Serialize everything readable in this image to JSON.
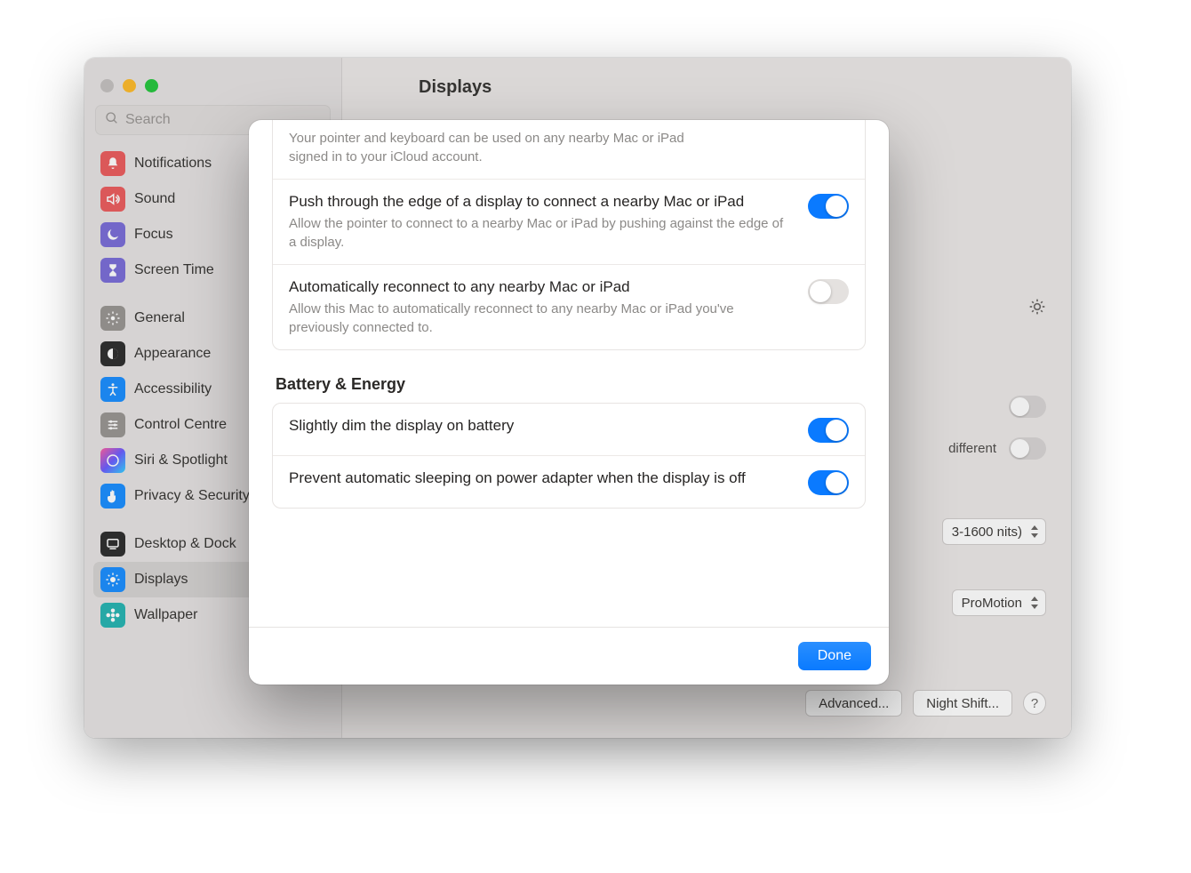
{
  "header": {
    "title": "Displays"
  },
  "search": {
    "placeholder": "Search"
  },
  "sidebar": {
    "items": [
      {
        "label": "Notifications",
        "icon": "bell-icon",
        "color": "#ec5f60"
      },
      {
        "label": "Sound",
        "icon": "speaker-icon",
        "color": "#ec5f60"
      },
      {
        "label": "Focus",
        "icon": "moon-icon",
        "color": "#7c6fd9"
      },
      {
        "label": "Screen Time",
        "icon": "hourglass-icon",
        "color": "#7c6fd9"
      }
    ],
    "items2": [
      {
        "label": "General",
        "icon": "gear-icon",
        "color": "#9a9794"
      },
      {
        "label": "Appearance",
        "icon": "appearance-icon",
        "color": "#313131"
      },
      {
        "label": "Accessibility",
        "icon": "accessibility-icon",
        "color": "#1e90ff"
      },
      {
        "label": "Control Centre",
        "icon": "sliders-icon",
        "color": "#9a9794"
      },
      {
        "label": "Siri & Spotlight",
        "icon": "siri-icon",
        "color": "#3a3a3a"
      },
      {
        "label": "Privacy & Security",
        "icon": "hand-icon",
        "color": "#1e90ff"
      }
    ],
    "items3": [
      {
        "label": "Desktop & Dock",
        "icon": "dock-icon",
        "color": "#313131"
      },
      {
        "label": "Displays",
        "icon": "brightness-icon",
        "color": "#1e90ff",
        "selected": true
      },
      {
        "label": "Wallpaper",
        "icon": "flower-icon",
        "color": "#29b5b3"
      }
    ]
  },
  "background": {
    "different_label": "different",
    "preset_label": "3-1600 nits)",
    "refresh_label": "ProMotion",
    "advanced_button": "Advanced...",
    "night_shift_button": "Night Shift..."
  },
  "modal": {
    "top_cut_text_line1": "Your pointer and keyboard can be used on any nearby Mac or iPad",
    "top_cut_text_line2": "signed in to your iCloud account.",
    "rows": [
      {
        "title": "Push through the edge of a display to connect a nearby Mac or iPad",
        "sub": "Allow the pointer to connect to a nearby Mac or iPad by pushing against the edge of a display.",
        "on": true
      },
      {
        "title": "Automatically reconnect to any nearby Mac or iPad",
        "sub": "Allow this Mac to automatically reconnect to any nearby Mac or iPad you've previously connected to.",
        "on": false
      }
    ],
    "section2_header": "Battery & Energy",
    "rows2": [
      {
        "title": "Slightly dim the display on battery",
        "on": true
      },
      {
        "title": "Prevent automatic sleeping on power adapter when the display is off",
        "on": true
      }
    ],
    "done_label": "Done"
  }
}
